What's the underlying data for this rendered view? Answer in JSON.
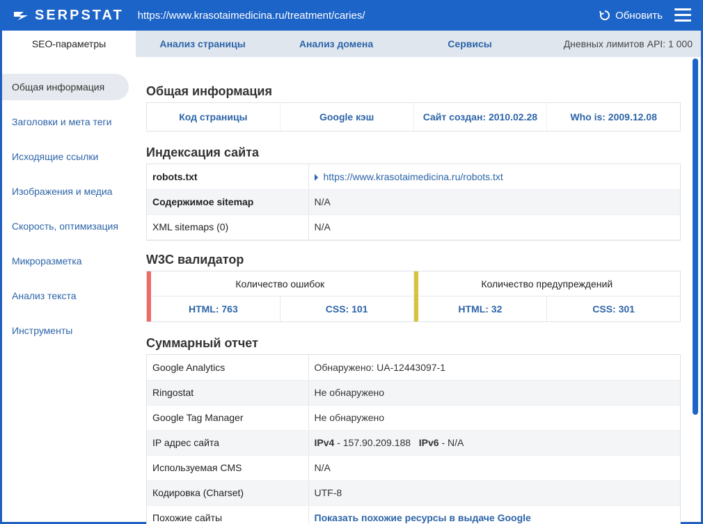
{
  "header": {
    "logo_text": "SERPSTAT",
    "url": "https://www.krasotaimedicina.ru/treatment/caries/",
    "refresh_label": "Обновить"
  },
  "tabs": [
    {
      "label": "SEO-параметры"
    },
    {
      "label": "Анализ страницы"
    },
    {
      "label": "Анализ домена"
    },
    {
      "label": "Сервисы"
    }
  ],
  "api_limit": "Дневных лимитов API: 1 000",
  "sidebar": {
    "items": [
      {
        "label": "Общая информация"
      },
      {
        "label": "Заголовки и мета теги"
      },
      {
        "label": "Исходящие ссылки"
      },
      {
        "label": "Изображения и медиа"
      },
      {
        "label": "Скорость, оптимизация"
      },
      {
        "label": "Микроразметка"
      },
      {
        "label": "Анализ текста"
      },
      {
        "label": "Инструменты"
      }
    ]
  },
  "general": {
    "title": "Общая информация",
    "page_code": "Код страницы",
    "google_cache": "Google кэш",
    "site_created": "Сайт создан: 2010.02.28",
    "whois": "Who is: 2009.12.08"
  },
  "indexing": {
    "title": "Индексация сайта",
    "rows": [
      {
        "key": "robots.txt",
        "value": "https://www.krasotaimedicina.ru/robots.txt"
      },
      {
        "key": "Содержимое sitemap",
        "value": "N/A"
      },
      {
        "key": "XML sitemaps (0)",
        "value": "N/A"
      }
    ]
  },
  "w3c": {
    "title": "W3C валидатор",
    "errors_label": "Количество ошибок",
    "errors_html": "HTML: 763",
    "errors_css": "CSS: 101",
    "warnings_label": "Количество предупреждений",
    "warnings_html": "HTML: 32",
    "warnings_css": "CSS: 301",
    "error_color": "#ee6b63",
    "warning_color": "#d7c43a"
  },
  "summary": {
    "title": "Суммарный отчет",
    "rows": [
      {
        "key": "Google Analytics",
        "value": "Обнаружено: UA-12443097-1"
      },
      {
        "key": "Ringostat",
        "value": "Не обнаружено"
      },
      {
        "key": "Google Tag Manager",
        "value": "Не обнаружено"
      },
      {
        "key": "IP адрес сайта",
        "ipv4_label": "IPv4",
        "ipv4": " - 157.90.209.188",
        "ipv6_label": "IPv6",
        "ipv6": " - N/A"
      },
      {
        "key": "Используемая CMS",
        "value": "N/A"
      },
      {
        "key": "Кодировка (Charset)",
        "value": "UTF-8"
      },
      {
        "key": "Похожие сайты",
        "value": "Показать похожие ресурсы в выдаче Google"
      }
    ]
  },
  "colors": {
    "brand": "#1d64c8",
    "link": "#2c64a8"
  }
}
